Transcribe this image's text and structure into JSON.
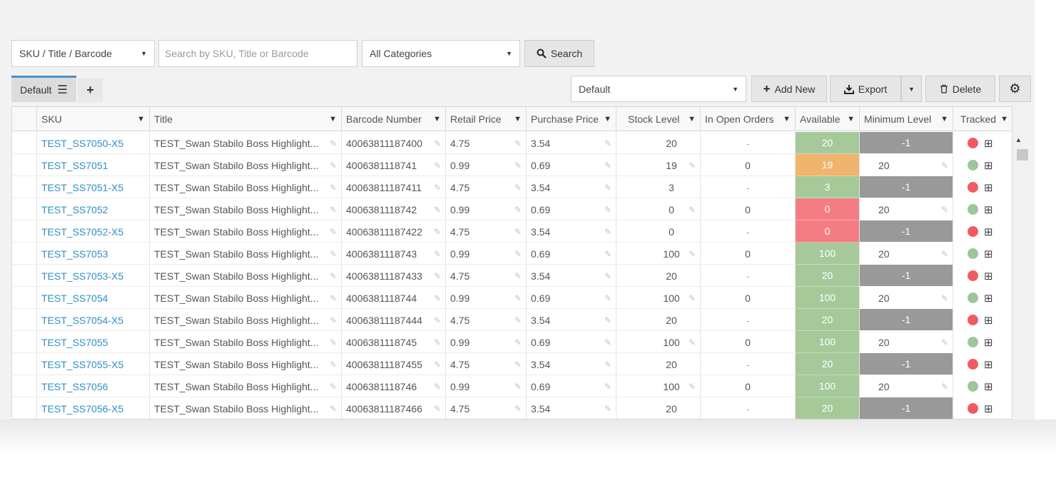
{
  "search": {
    "field_select": "SKU / Title / Barcode",
    "input_placeholder": "Search by SKU, Title or Barcode",
    "category_select": "All Categories",
    "search_button": "Search"
  },
  "views": {
    "active_tab": "Default",
    "view_select": "Default"
  },
  "toolbar": {
    "add_new": "Add New",
    "export": "Export",
    "delete": "Delete"
  },
  "columns": [
    "SKU",
    "Title",
    "Barcode Number",
    "Retail Price",
    "Purchase Price",
    "Stock Level",
    "In Open Orders",
    "Available",
    "Minimum Level",
    "Tracked"
  ],
  "colors": {
    "available_green": "#a6c99a",
    "available_orange": "#f0b46e",
    "available_red": "#f47d83",
    "min_level_gray": "#999999",
    "tracked_red": "#f05b63",
    "tracked_green": "#9dc69a",
    "link": "#2f8fc6"
  },
  "rows": [
    {
      "sku": "TEST_SS7050-X5",
      "title": "TEST_Swan Stabilo Boss Highlight...",
      "barcode": "40063811187400",
      "retail": "4.75",
      "purchase": "3.54",
      "stock": "20",
      "open_orders": "-",
      "available": "20",
      "available_status": "green",
      "min_level": "-1",
      "tracked": "red",
      "editable_stock": false
    },
    {
      "sku": "TEST_SS7051",
      "title": "TEST_Swan Stabilo Boss Highlight...",
      "barcode": "4006381118741",
      "retail": "0.99",
      "purchase": "0.69",
      "stock": "19",
      "open_orders": "0",
      "available": "19",
      "available_status": "orange",
      "min_level": "20",
      "tracked": "green",
      "editable_stock": true
    },
    {
      "sku": "TEST_SS7051-X5",
      "title": "TEST_Swan Stabilo Boss Highlight...",
      "barcode": "40063811187411",
      "retail": "4.75",
      "purchase": "3.54",
      "stock": "3",
      "open_orders": "-",
      "available": "3",
      "available_status": "green",
      "min_level": "-1",
      "tracked": "red",
      "editable_stock": false
    },
    {
      "sku": "TEST_SS7052",
      "title": "TEST_Swan Stabilo Boss Highlight...",
      "barcode": "4006381118742",
      "retail": "0.99",
      "purchase": "0.69",
      "stock": "0",
      "open_orders": "0",
      "available": "0",
      "available_status": "red",
      "min_level": "20",
      "tracked": "green",
      "editable_stock": true
    },
    {
      "sku": "TEST_SS7052-X5",
      "title": "TEST_Swan Stabilo Boss Highlight...",
      "barcode": "40063811187422",
      "retail": "4.75",
      "purchase": "3.54",
      "stock": "0",
      "open_orders": "-",
      "available": "0",
      "available_status": "red",
      "min_level": "-1",
      "tracked": "red",
      "editable_stock": false
    },
    {
      "sku": "TEST_SS7053",
      "title": "TEST_Swan Stabilo Boss Highlight...",
      "barcode": "4006381118743",
      "retail": "0.99",
      "purchase": "0.69",
      "stock": "100",
      "open_orders": "0",
      "available": "100",
      "available_status": "green",
      "min_level": "20",
      "tracked": "green",
      "editable_stock": true
    },
    {
      "sku": "TEST_SS7053-X5",
      "title": "TEST_Swan Stabilo Boss Highlight...",
      "barcode": "40063811187433",
      "retail": "4.75",
      "purchase": "3.54",
      "stock": "20",
      "open_orders": "-",
      "available": "20",
      "available_status": "green",
      "min_level": "-1",
      "tracked": "red",
      "editable_stock": false
    },
    {
      "sku": "TEST_SS7054",
      "title": "TEST_Swan Stabilo Boss Highlight...",
      "barcode": "4006381118744",
      "retail": "0.99",
      "purchase": "0.69",
      "stock": "100",
      "open_orders": "0",
      "available": "100",
      "available_status": "green",
      "min_level": "20",
      "tracked": "green",
      "editable_stock": true
    },
    {
      "sku": "TEST_SS7054-X5",
      "title": "TEST_Swan Stabilo Boss Highlight...",
      "barcode": "40063811187444",
      "retail": "4.75",
      "purchase": "3.54",
      "stock": "20",
      "open_orders": "-",
      "available": "20",
      "available_status": "green",
      "min_level": "-1",
      "tracked": "red",
      "editable_stock": false
    },
    {
      "sku": "TEST_SS7055",
      "title": "TEST_Swan Stabilo Boss Highlight...",
      "barcode": "4006381118745",
      "retail": "0.99",
      "purchase": "0.69",
      "stock": "100",
      "open_orders": "0",
      "available": "100",
      "available_status": "green",
      "min_level": "20",
      "tracked": "green",
      "editable_stock": true
    },
    {
      "sku": "TEST_SS7055-X5",
      "title": "TEST_Swan Stabilo Boss Highlight...",
      "barcode": "40063811187455",
      "retail": "4.75",
      "purchase": "3.54",
      "stock": "20",
      "open_orders": "-",
      "available": "20",
      "available_status": "green",
      "min_level": "-1",
      "tracked": "red",
      "editable_stock": false
    },
    {
      "sku": "TEST_SS7056",
      "title": "TEST_Swan Stabilo Boss Highlight...",
      "barcode": "4006381118746",
      "retail": "0.99",
      "purchase": "0.69",
      "stock": "100",
      "open_orders": "0",
      "available": "100",
      "available_status": "green",
      "min_level": "20",
      "tracked": "green",
      "editable_stock": true
    },
    {
      "sku": "TEST_SS7056-X5",
      "title": "TEST_Swan Stabilo Boss Highlight...",
      "barcode": "40063811187466",
      "retail": "4.75",
      "purchase": "3.54",
      "stock": "20",
      "open_orders": "-",
      "available": "20",
      "available_status": "green",
      "min_level": "-1",
      "tracked": "red",
      "editable_stock": false
    }
  ]
}
